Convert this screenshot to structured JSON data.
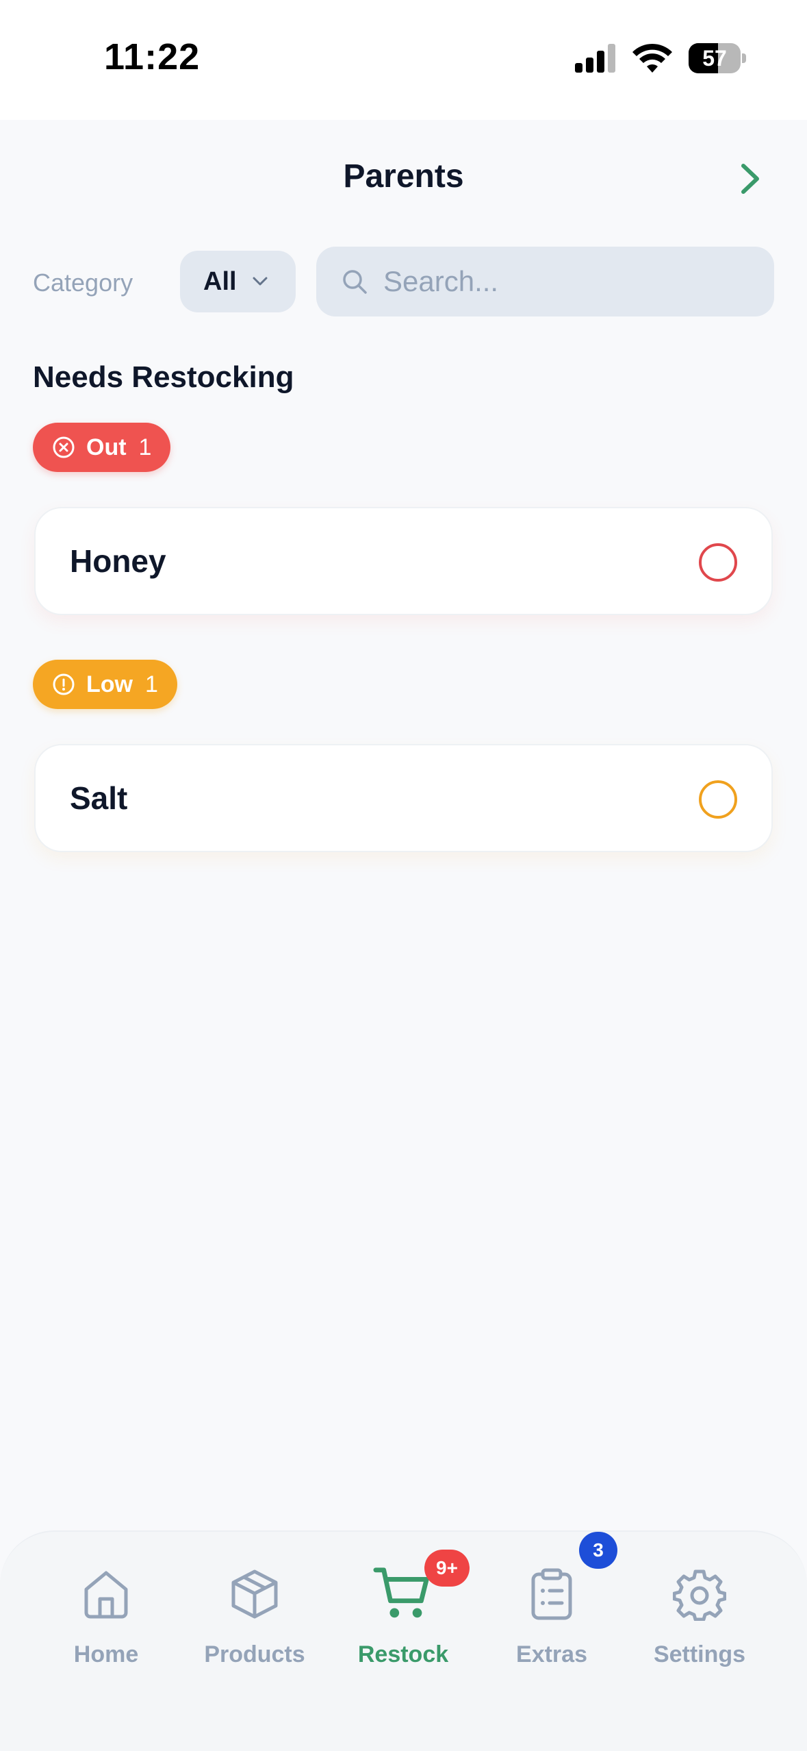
{
  "status_bar": {
    "time": "11:22",
    "battery_percent": "57"
  },
  "header": {
    "title": "Parents",
    "next_icon": "chevron-right-icon"
  },
  "filters": {
    "category_label": "Category",
    "category_value": "All",
    "search_placeholder": "Search..."
  },
  "section": {
    "title": "Needs Restocking"
  },
  "groups": [
    {
      "badge_label": "Out",
      "badge_count": "1",
      "badge_icon": "x-circle-icon",
      "color": "#ef5350",
      "items": [
        {
          "name": "Honey"
        }
      ]
    },
    {
      "badge_label": "Low",
      "badge_count": "1",
      "badge_icon": "alert-circle-icon",
      "color": "#f5a623",
      "items": [
        {
          "name": "Salt"
        }
      ]
    }
  ],
  "nav": {
    "items": [
      {
        "label": "Home",
        "icon": "home-icon"
      },
      {
        "label": "Products",
        "icon": "package-icon"
      },
      {
        "label": "Restock",
        "icon": "cart-icon",
        "badge": "9+",
        "active": true
      },
      {
        "label": "Extras",
        "icon": "clipboard-list-icon",
        "badge": "3"
      },
      {
        "label": "Settings",
        "icon": "gear-icon"
      }
    ]
  },
  "colors": {
    "accent": "#3a9a6a",
    "out": "#ef5350",
    "low": "#f5a623",
    "muted": "#94a3b8"
  }
}
